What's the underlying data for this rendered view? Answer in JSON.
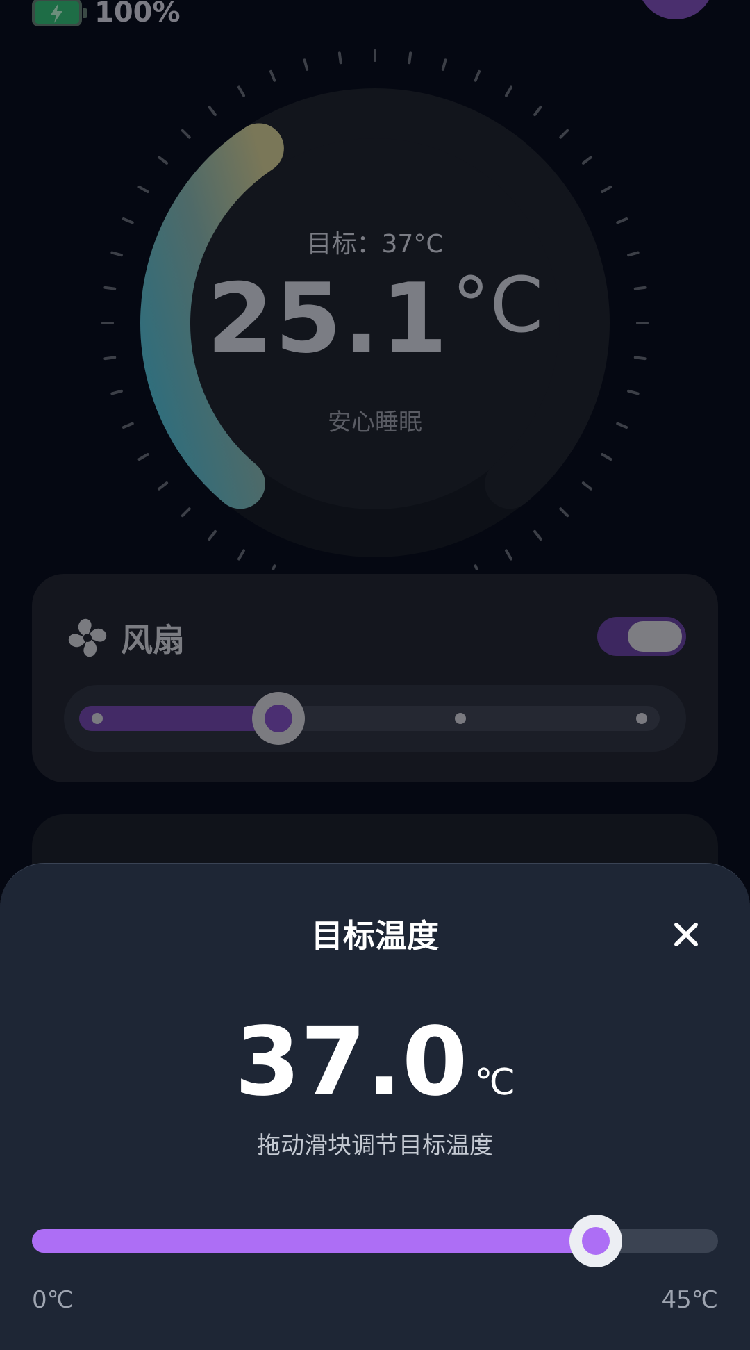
{
  "status": {
    "battery_text": "100%",
    "battery_icon": "battery-charging-icon"
  },
  "gauge": {
    "target_label": "目标：37°C",
    "current_value": "25.1",
    "current_unit": "°C",
    "mode_label": "安心睡眠",
    "arc_fill_fraction": 0.38
  },
  "fan_card": {
    "icon": "fan-icon",
    "title": "风扇",
    "toggle_on": true,
    "level_steps": 4,
    "level_selected": 2
  },
  "sheet": {
    "title": "目标温度",
    "close_icon": "close-icon",
    "value": "37.0",
    "unit": "℃",
    "hint": "拖动滑块调节目标温度",
    "slider": {
      "min_label": "0℃",
      "max_label": "45℃",
      "min": 0,
      "max": 45,
      "value": 37
    }
  },
  "colors": {
    "background": "#050812",
    "sheet": "#1e2635",
    "accent": "#ad6ef5",
    "accent_dim": "#432a66",
    "arc_start": "#2e6f7f",
    "arc_end": "#7a7a5a"
  }
}
